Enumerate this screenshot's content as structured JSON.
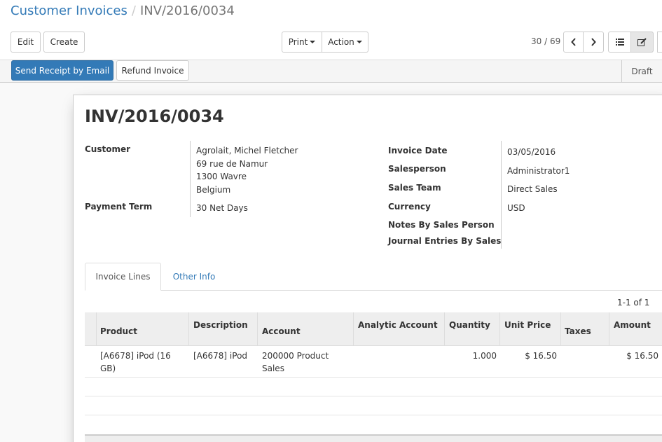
{
  "breadcrumb": {
    "parent": "Customer Invoices",
    "separator": "/",
    "current": "INV/2016/0034"
  },
  "toolbar": {
    "edit_label": "Edit",
    "create_label": "Create",
    "print_label": "Print",
    "action_label": "Action"
  },
  "pager": {
    "value": "30 / 69"
  },
  "view_switcher": {
    "list_icon": "list-icon",
    "form_icon": "edit-form-icon"
  },
  "statusbar": {
    "send_receipt_label": "Send Receipt by Email",
    "refund_label": "Refund Invoice",
    "status_label": "Draft"
  },
  "invoice": {
    "number": "INV/2016/0034",
    "customer_label": "Customer",
    "customer_name": "Agrolait, Michel Fletcher",
    "customer_address": [
      "69 rue de Namur",
      "1300 Wavre",
      "Belgium"
    ],
    "payment_term_label": "Payment Term",
    "payment_term": "30 Net Days",
    "invoice_date_label": "Invoice Date",
    "invoice_date": "03/05/2016",
    "salesperson_label": "Salesperson",
    "salesperson": "Administrator1",
    "sales_team_label": "Sales Team",
    "sales_team": "Direct Sales",
    "currency_label": "Currency",
    "currency": "USD",
    "notes_label": "Notes By Sales Person",
    "journal_label": "Journal Entries By Sales"
  },
  "tabs": {
    "invoice_lines": "Invoice Lines",
    "other_info": "Other Info"
  },
  "lines": {
    "pager": "1-1 of 1",
    "headers": {
      "product": "Product",
      "description": "Description",
      "account": "Account",
      "analytic": "Analytic Account",
      "quantity": "Quantity",
      "unit_price": "Unit Price",
      "taxes": "Taxes",
      "amount": "Amount"
    },
    "rows": [
      {
        "product": "[A6678] iPod (16 GB)",
        "description": "[A6678] iPod",
        "account": "200000 Product Sales",
        "analytic": "",
        "quantity": "1.000",
        "unit_price": "$ 16.50",
        "taxes": "",
        "amount": "$ 16.50"
      }
    ]
  },
  "colors": {
    "accent": "#337ab7",
    "status_bg": "#f5f5f5"
  }
}
